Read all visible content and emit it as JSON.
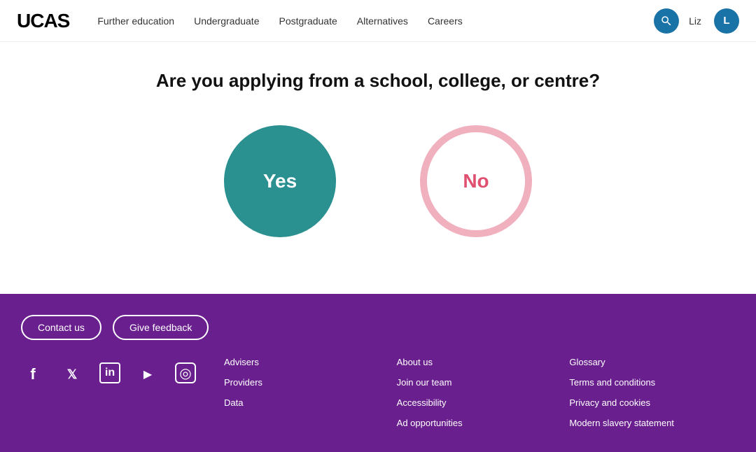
{
  "header": {
    "logo": "UCAS",
    "nav": [
      {
        "label": "Further education",
        "id": "further-education"
      },
      {
        "label": "Undergraduate",
        "id": "undergraduate"
      },
      {
        "label": "Postgraduate",
        "id": "postgraduate"
      },
      {
        "label": "Alternatives",
        "id": "alternatives"
      },
      {
        "label": "Careers",
        "id": "careers"
      }
    ],
    "user_name": "Liz",
    "user_initial": "L"
  },
  "main": {
    "question": "Are you applying from a school, college, or centre?",
    "yes_label": "Yes",
    "no_label": "No"
  },
  "footer": {
    "contact_us": "Contact us",
    "give_feedback": "Give feedback",
    "col1": [
      {
        "label": "Advisers"
      },
      {
        "label": "Providers"
      },
      {
        "label": "Data"
      }
    ],
    "col2": [
      {
        "label": "About us"
      },
      {
        "label": "Join our team"
      },
      {
        "label": "Accessibility"
      },
      {
        "label": "Ad opportunities"
      }
    ],
    "col3": [
      {
        "label": "Glossary"
      },
      {
        "label": "Terms and conditions"
      },
      {
        "label": "Privacy and cookies"
      },
      {
        "label": "Modern slavery statement"
      }
    ],
    "social": [
      {
        "name": "facebook",
        "symbol": "f"
      },
      {
        "name": "twitter",
        "symbol": "𝕏"
      },
      {
        "name": "linkedin",
        "symbol": "in"
      },
      {
        "name": "youtube",
        "symbol": "▶"
      },
      {
        "name": "instagram",
        "symbol": "◎"
      }
    ]
  }
}
